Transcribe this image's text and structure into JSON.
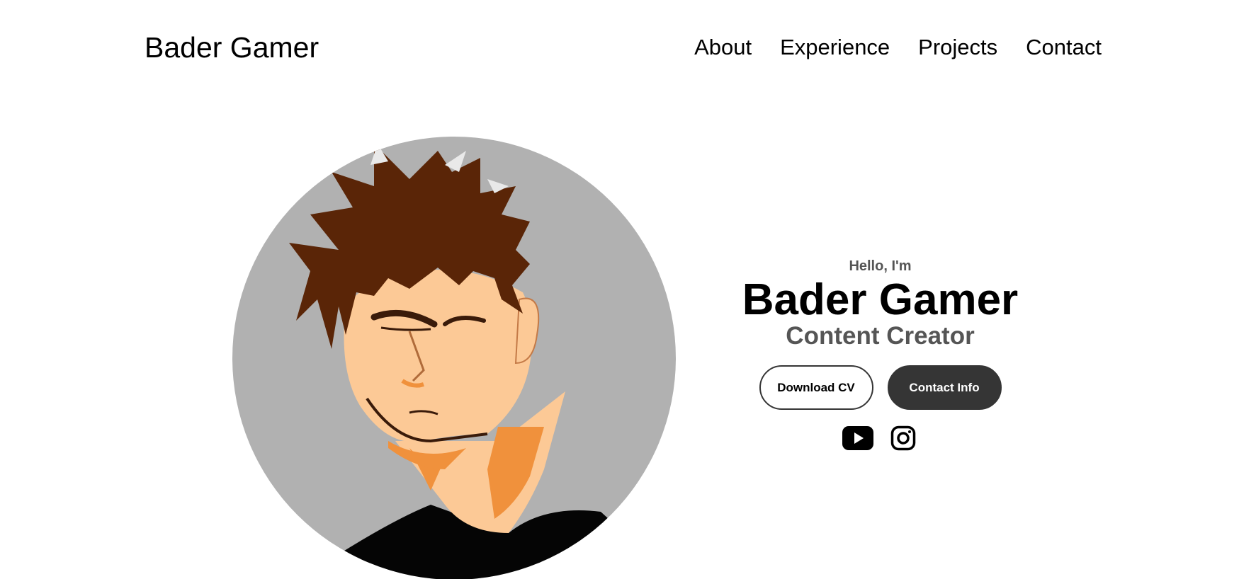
{
  "nav": {
    "logo": "Bader Gamer",
    "links": [
      {
        "label": "About"
      },
      {
        "label": "Experience"
      },
      {
        "label": "Projects"
      },
      {
        "label": "Contact"
      }
    ]
  },
  "profile": {
    "image_alt": "cartoon avatar of a man with spiky brown hair"
  },
  "hero": {
    "greeting": "Hello, I'm",
    "name": "Bader Gamer",
    "role": "Content Creator",
    "buttons": {
      "download_cv": "Download CV",
      "contact_info": "Contact Info"
    },
    "socials": [
      {
        "icon": "youtube-icon"
      },
      {
        "icon": "instagram-icon"
      }
    ]
  },
  "colors": {
    "accent_dark": "#353535",
    "subtext": "#555555",
    "avatar_bg": "#b1b1b1",
    "hair": "#5a2507",
    "skin": "#fcc996",
    "skin_shadow": "#f0913c"
  }
}
